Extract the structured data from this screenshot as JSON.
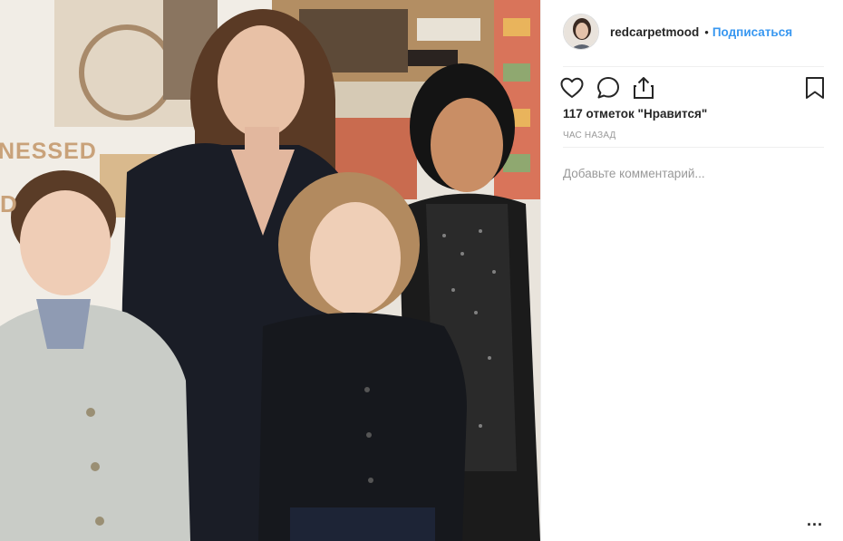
{
  "post": {
    "poster_text": "NESSED",
    "poster_letter": "D"
  },
  "header": {
    "username": "redcarpetmood",
    "separator": "•",
    "follow_label": "Подписаться"
  },
  "actions": {
    "like_icon": "heart-icon",
    "comment_icon": "comment-icon",
    "share_icon": "share-icon",
    "save_icon": "bookmark-icon"
  },
  "stats": {
    "likes": "117 отметок \"Нравится\"",
    "time": "час назад"
  },
  "comment": {
    "placeholder": "Добавьте комментарий..."
  },
  "menu": {
    "more_label": "..."
  },
  "colors": {
    "link": "#3897f0",
    "muted": "#999999",
    "text": "#262626",
    "divider": "#efefef"
  }
}
